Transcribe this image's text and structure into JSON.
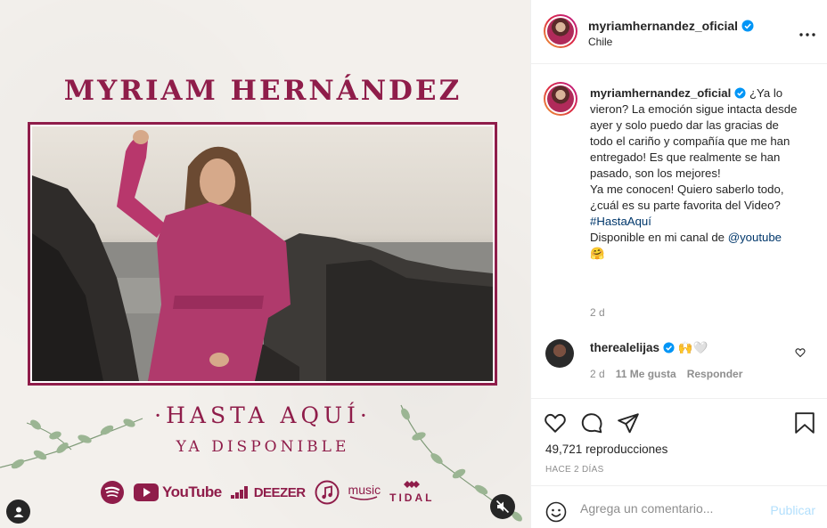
{
  "media": {
    "artist_title": "MYRIAM HERNÁNDEZ",
    "song_title": "·HASTA AQUÍ·",
    "song_subtitle": "YA DISPONIBLE",
    "platforms": {
      "youtube": "YouTube",
      "deezer": "DEEZER",
      "apple_music": "music",
      "tidal": "TIDAL"
    },
    "accent_color": "#8f1d4a"
  },
  "header": {
    "username": "myriamhernandez_oficial",
    "location": "Chile",
    "more_icon": "more-horizontal-icon"
  },
  "caption": {
    "username": "myriamhernandez_oficial",
    "text_1": "¿Ya lo vieron? La emoción sigue intacta desde ayer y solo puedo dar las gracias de todo el cariño y compañía que me han entregado! Es que realmente se han pasado, son los mejores!",
    "text_2": "Ya me conocen! Quiero saberlo todo, ¿cuál es su parte favorita del Video?",
    "hashtag": "#HastaAquí",
    "text_3": "Disponible en mi canal de ",
    "mention": "@youtube",
    "emoji": "🤗",
    "time": "2 d"
  },
  "comment": {
    "username": "therealelijas",
    "text": "🙌🤍",
    "time": "2 d",
    "likes": "11 Me gusta",
    "reply": "Responder"
  },
  "stats": {
    "views_count": "49,721",
    "views_label": "reproducciones",
    "date": "HACE 2 DÍAS"
  },
  "add_comment": {
    "placeholder": "Agrega un comentario...",
    "post_label": "Publicar"
  }
}
